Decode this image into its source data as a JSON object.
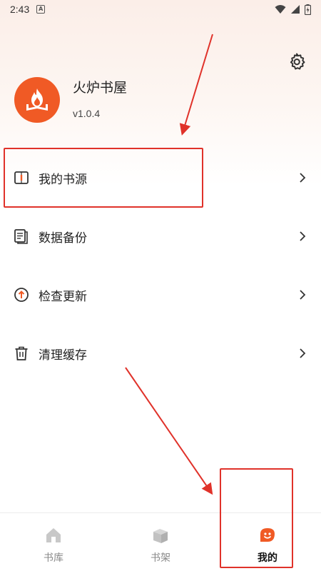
{
  "status_bar": {
    "time": "2:43",
    "notification_letter": "A"
  },
  "profile": {
    "app_name": "火炉书屋",
    "version": "v1.0.4"
  },
  "menu": {
    "items": [
      {
        "label": "我的书源",
        "icon": "book-source-icon"
      },
      {
        "label": "数据备份",
        "icon": "backup-icon"
      },
      {
        "label": "检查更新",
        "icon": "update-icon"
      },
      {
        "label": "清理缓存",
        "icon": "trash-icon"
      }
    ]
  },
  "tabbar": {
    "tabs": [
      {
        "label": "书库",
        "icon": "home-icon"
      },
      {
        "label": "书架",
        "icon": "bookshelf-icon"
      },
      {
        "label": "我的",
        "icon": "me-icon",
        "active": true
      }
    ]
  },
  "colors": {
    "accent": "#f05a25",
    "annotation": "#e0322a"
  }
}
